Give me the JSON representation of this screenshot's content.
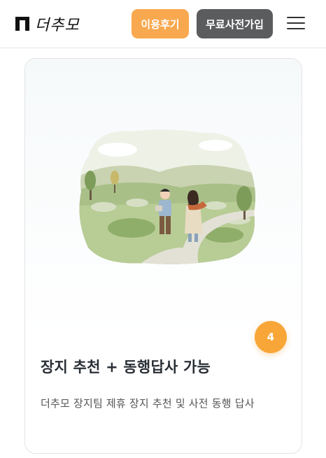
{
  "header": {
    "logo_text": "더추모",
    "review_button": "이용후기",
    "signup_button": "무료사전가입"
  },
  "card": {
    "badge_number": "4",
    "title": "장지 추천 + 동행답사 가능",
    "description": "더추모 장지팀 제휴 장지 추천 및 사전 동행 답사"
  },
  "colors": {
    "accent_orange": "#f8a84e",
    "dark_button": "#5b5c5e"
  }
}
